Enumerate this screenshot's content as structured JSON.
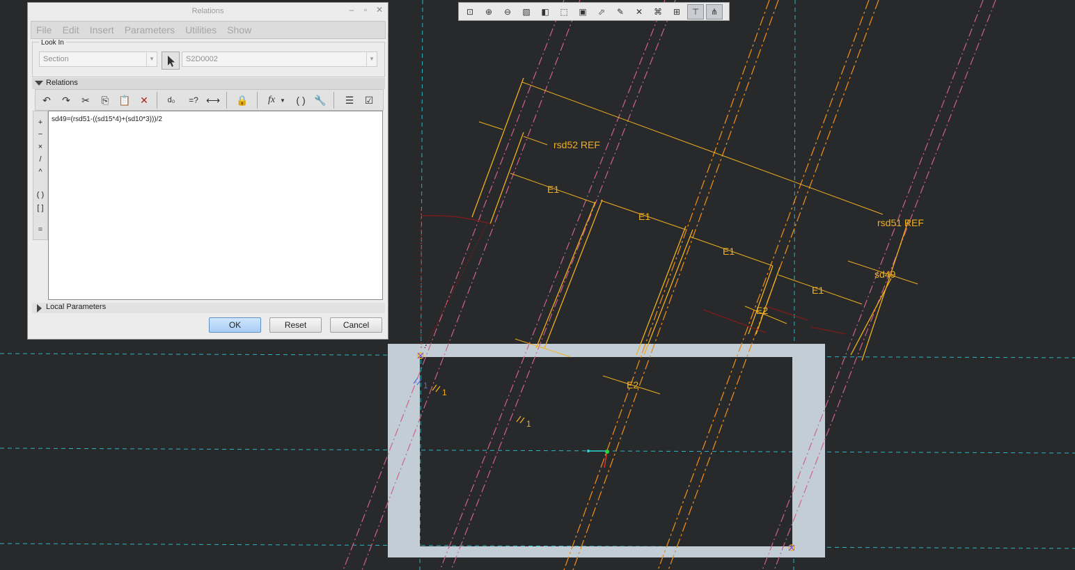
{
  "dialog": {
    "title": "Relations",
    "menu": [
      "File",
      "Edit",
      "Insert",
      "Parameters",
      "Utilities",
      "Show"
    ],
    "look_in": {
      "label": "Look In",
      "type_value": "Section",
      "item_value": "S2D0002"
    },
    "relations": {
      "label": "Relations",
      "text": "sd49=(rsd51-((sd15*4)+(sd10*3)))/2"
    },
    "operators": [
      "+",
      "−",
      "×",
      "/",
      "^",
      "( )",
      "[ ]",
      "="
    ],
    "local_parameters_label": "Local Parameters",
    "buttons": {
      "ok": "OK",
      "reset": "Reset",
      "cancel": "Cancel"
    }
  },
  "sketch": {
    "dimensions": {
      "rsd52": "rsd52 REF",
      "rsd51": "rsd51 REF",
      "e1": "E1",
      "e2": "E2",
      "sd49": "sd49",
      "constraint_1": "1"
    }
  },
  "colors": {
    "background": "#28292b",
    "dimension": "#f0b020",
    "centerline": "#d0628a",
    "guide": "#2bb6c4",
    "frame": "#c2cdd6"
  },
  "toolbar_icons": [
    "refit-icon",
    "zoom-in-icon",
    "zoom-out-icon",
    "repaint-icon",
    "display-style-icon",
    "saved-views-icon",
    "view-manager-icon",
    "datum-display-icon",
    "annotation-display-icon",
    "spin-center-icon",
    "sketch-display-icon",
    "dimension-display-icon",
    "constraint-display-icon",
    "vertex-display-icon"
  ]
}
